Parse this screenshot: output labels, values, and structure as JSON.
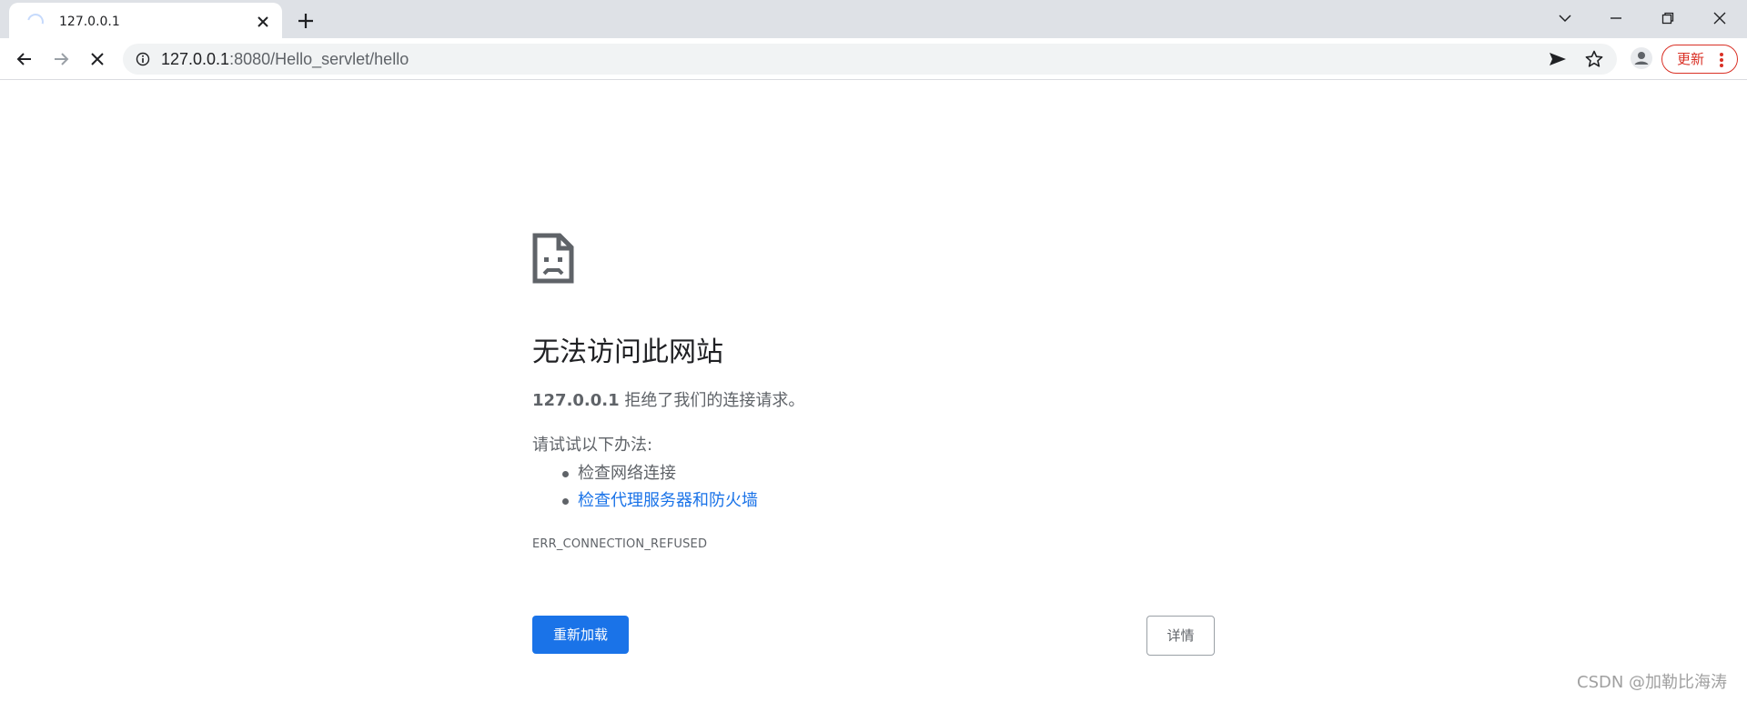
{
  "browser": {
    "tab": {
      "title": "127.0.0.1"
    },
    "address": {
      "host": "127.0.0.1",
      "path": ":8080/Hello_servlet/hello"
    },
    "update_label": "更新"
  },
  "error": {
    "title": "无法访问此网站",
    "host": "127.0.0.1",
    "message": " 拒绝了我们的连接请求。",
    "try_label": "请试试以下办法:",
    "suggestions": [
      "检查网络连接",
      "检查代理服务器和防火墙"
    ],
    "code": "ERR_CONNECTION_REFUSED",
    "reload_label": "重新加载",
    "details_label": "详情"
  },
  "watermark": "CSDN @加勒比海涛",
  "colors": {
    "accent": "#1a73e8",
    "update": "#d93025",
    "text": "#5f6368"
  },
  "icons": [
    "loading-spinner-icon",
    "close-icon",
    "plus-icon",
    "chevron-down-icon",
    "minimize-icon",
    "restore-icon",
    "back-arrow-icon",
    "forward-arrow-icon",
    "stop-icon",
    "info-icon",
    "send-icon",
    "star-icon",
    "profile-icon",
    "more-vert-icon",
    "sad-page-icon"
  ]
}
